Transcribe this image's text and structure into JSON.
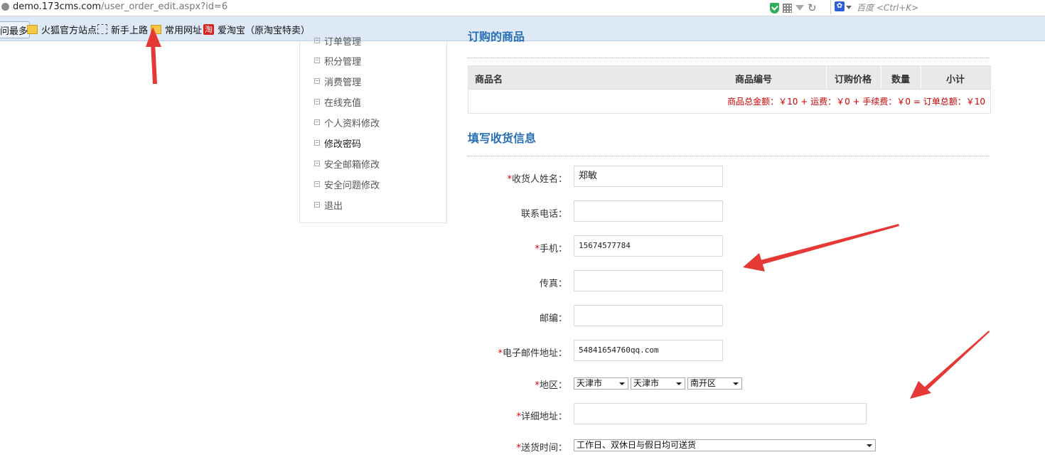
{
  "browser": {
    "url_host": "demo.173cms.com",
    "url_path": "/user_order_edit.aspx?id=6",
    "search_placeholder": "百度 <Ctrl+K>"
  },
  "bookmarks": [
    {
      "label": "问最多"
    },
    {
      "label": "火狐官方站点"
    },
    {
      "label": "新手上路"
    },
    {
      "label": "常用网址"
    },
    {
      "label": "爱淘宝（原淘宝特卖）"
    }
  ],
  "bookmark_icons": {
    "taobao": "淘"
  },
  "menu": {
    "items": [
      "订单管理",
      "积分管理",
      "消费管理",
      "在线充值",
      "个人资料修改",
      "修改密码",
      "安全邮箱修改",
      "安全问题修改",
      "退出"
    ]
  },
  "order": {
    "section_title": "订购的商品",
    "columns": [
      "商品名",
      "商品编号",
      "订购价格",
      "数量",
      "小计"
    ],
    "total_line": "商品总金额：￥10 + 运费：￥0 + 手续费：￥0 = 订单总额：￥10"
  },
  "shipping": {
    "section_title": "填写收货信息",
    "required_mark": "*",
    "fields": {
      "name": {
        "label": "收货人姓名：",
        "value": "郑敏"
      },
      "phone": {
        "label": "联系电话：",
        "value": ""
      },
      "mobile": {
        "label": "手机：",
        "value": "15674577784"
      },
      "fax": {
        "label": "传真：",
        "value": ""
      },
      "zip": {
        "label": "邮编：",
        "value": ""
      },
      "email": {
        "label": "电子邮件地址：",
        "value": "54841654760qq.com"
      },
      "region": {
        "label": "地区：",
        "province": "天津市",
        "city": "天津市",
        "district": "南开区"
      },
      "address": {
        "label": "详细地址：",
        "value": ""
      },
      "delivery_time": {
        "label": "送货时间：",
        "value": "工作日、双休日与假日均可送货"
      }
    }
  },
  "colors": {
    "accent": "#2a6fb5",
    "total": "#cc0000",
    "annotation": "#e53935"
  }
}
